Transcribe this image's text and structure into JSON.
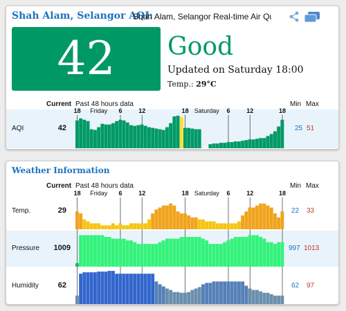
{
  "aqi_card": {
    "title": "Shah Alam, Selangor AQI:",
    "subtitle": "Shah Alam, Selangor Real-time Air Qua",
    "aqi_value": "42",
    "level": "Good",
    "updated": "Updated on Saturday 18:00",
    "temp_label": "Temp.:",
    "temp_value": "29°C",
    "colors": {
      "good": "#009966",
      "moderate": "#ffde33",
      "title": "#1c73bd"
    },
    "icons": [
      "share-icon",
      "message-icon"
    ]
  },
  "table_headers": {
    "current": "Current",
    "past": "Past 48 hours data",
    "min": "Min",
    "max": "Max"
  },
  "timeline": {
    "ticks": [
      "18",
      "6",
      "12",
      "18",
      "6",
      "12",
      "18"
    ],
    "days": [
      "Friday",
      "Saturday"
    ]
  },
  "aqi_row": {
    "label": "AQI",
    "current": "42",
    "min": "25",
    "max": "51"
  },
  "weather_card": {
    "title": "Weather Information"
  },
  "weather_rows": [
    {
      "key": "temp",
      "label": "Temp.",
      "current": "29",
      "min": "22",
      "max": "33"
    },
    {
      "key": "pressure",
      "label": "Pressure",
      "current": "1009",
      "min": "997",
      "max": "1013"
    },
    {
      "key": "humidity",
      "label": "Humidity",
      "current": "62",
      "min": "62",
      "max": "97"
    }
  ],
  "chart_data": [
    {
      "type": "bar",
      "name": "AQI",
      "values": [
        41,
        44,
        42,
        40,
        28,
        27,
        31,
        36,
        35,
        35,
        37,
        40,
        42,
        41,
        38,
        34,
        33,
        34,
        35,
        33,
        31,
        30,
        29,
        28,
        27,
        31,
        37,
        47,
        48,
        46,
        30,
        30,
        29,
        28,
        28,
        0,
        0,
        6,
        7,
        7,
        8,
        8,
        9,
        9,
        10,
        10,
        11,
        12,
        13,
        13,
        14,
        15,
        15,
        18,
        21,
        25,
        32,
        42
      ]
    },
    {
      "type": "bar",
      "name": "Temp.",
      "values": [
        29,
        28,
        25,
        24,
        23,
        23,
        23,
        22,
        22,
        22,
        23,
        22,
        23,
        22,
        22,
        23,
        23,
        23,
        23,
        23,
        25,
        28,
        30,
        31,
        32,
        32,
        33,
        32,
        29,
        28,
        28,
        27,
        26,
        26,
        25,
        25,
        24,
        24,
        24,
        23,
        23,
        23,
        23,
        23,
        23,
        24,
        27,
        29,
        31,
        31,
        32,
        33,
        33,
        32,
        31,
        28,
        26,
        29
      ]
    },
    {
      "type": "bar",
      "name": "Pressure",
      "values": [
        997,
        1013,
        1013,
        1013,
        1013,
        1013,
        1013,
        1013,
        1012,
        1012,
        1011,
        1011,
        1011,
        1011,
        1010,
        1010,
        1009,
        1008,
        1008,
        1008,
        1008,
        1008,
        1008,
        1009,
        1010,
        1011,
        1011,
        1011,
        1011,
        1012,
        1012,
        1012,
        1012,
        1012,
        1012,
        1011,
        1010,
        1008,
        1008,
        1008,
        1008,
        1009,
        1010,
        1011,
        1012,
        1012,
        1012,
        1012,
        1013,
        1013,
        1013,
        1012,
        1011,
        1009,
        1009,
        1008,
        1009,
        1009
      ]
    },
    {
      "type": "bar",
      "name": "Humidity",
      "values": [
        62,
        93,
        95,
        95,
        95,
        95,
        96,
        96,
        96,
        97,
        97,
        93,
        93,
        93,
        93,
        93,
        93,
        93,
        93,
        93,
        93,
        93,
        82,
        78,
        75,
        72,
        70,
        67,
        67,
        66,
        66,
        67,
        70,
        72,
        74,
        78,
        80,
        80,
        82,
        82,
        82,
        82,
        82,
        82,
        82,
        82,
        82,
        76,
        72,
        70,
        70,
        68,
        66,
        66,
        64,
        62,
        62,
        62
      ]
    }
  ]
}
